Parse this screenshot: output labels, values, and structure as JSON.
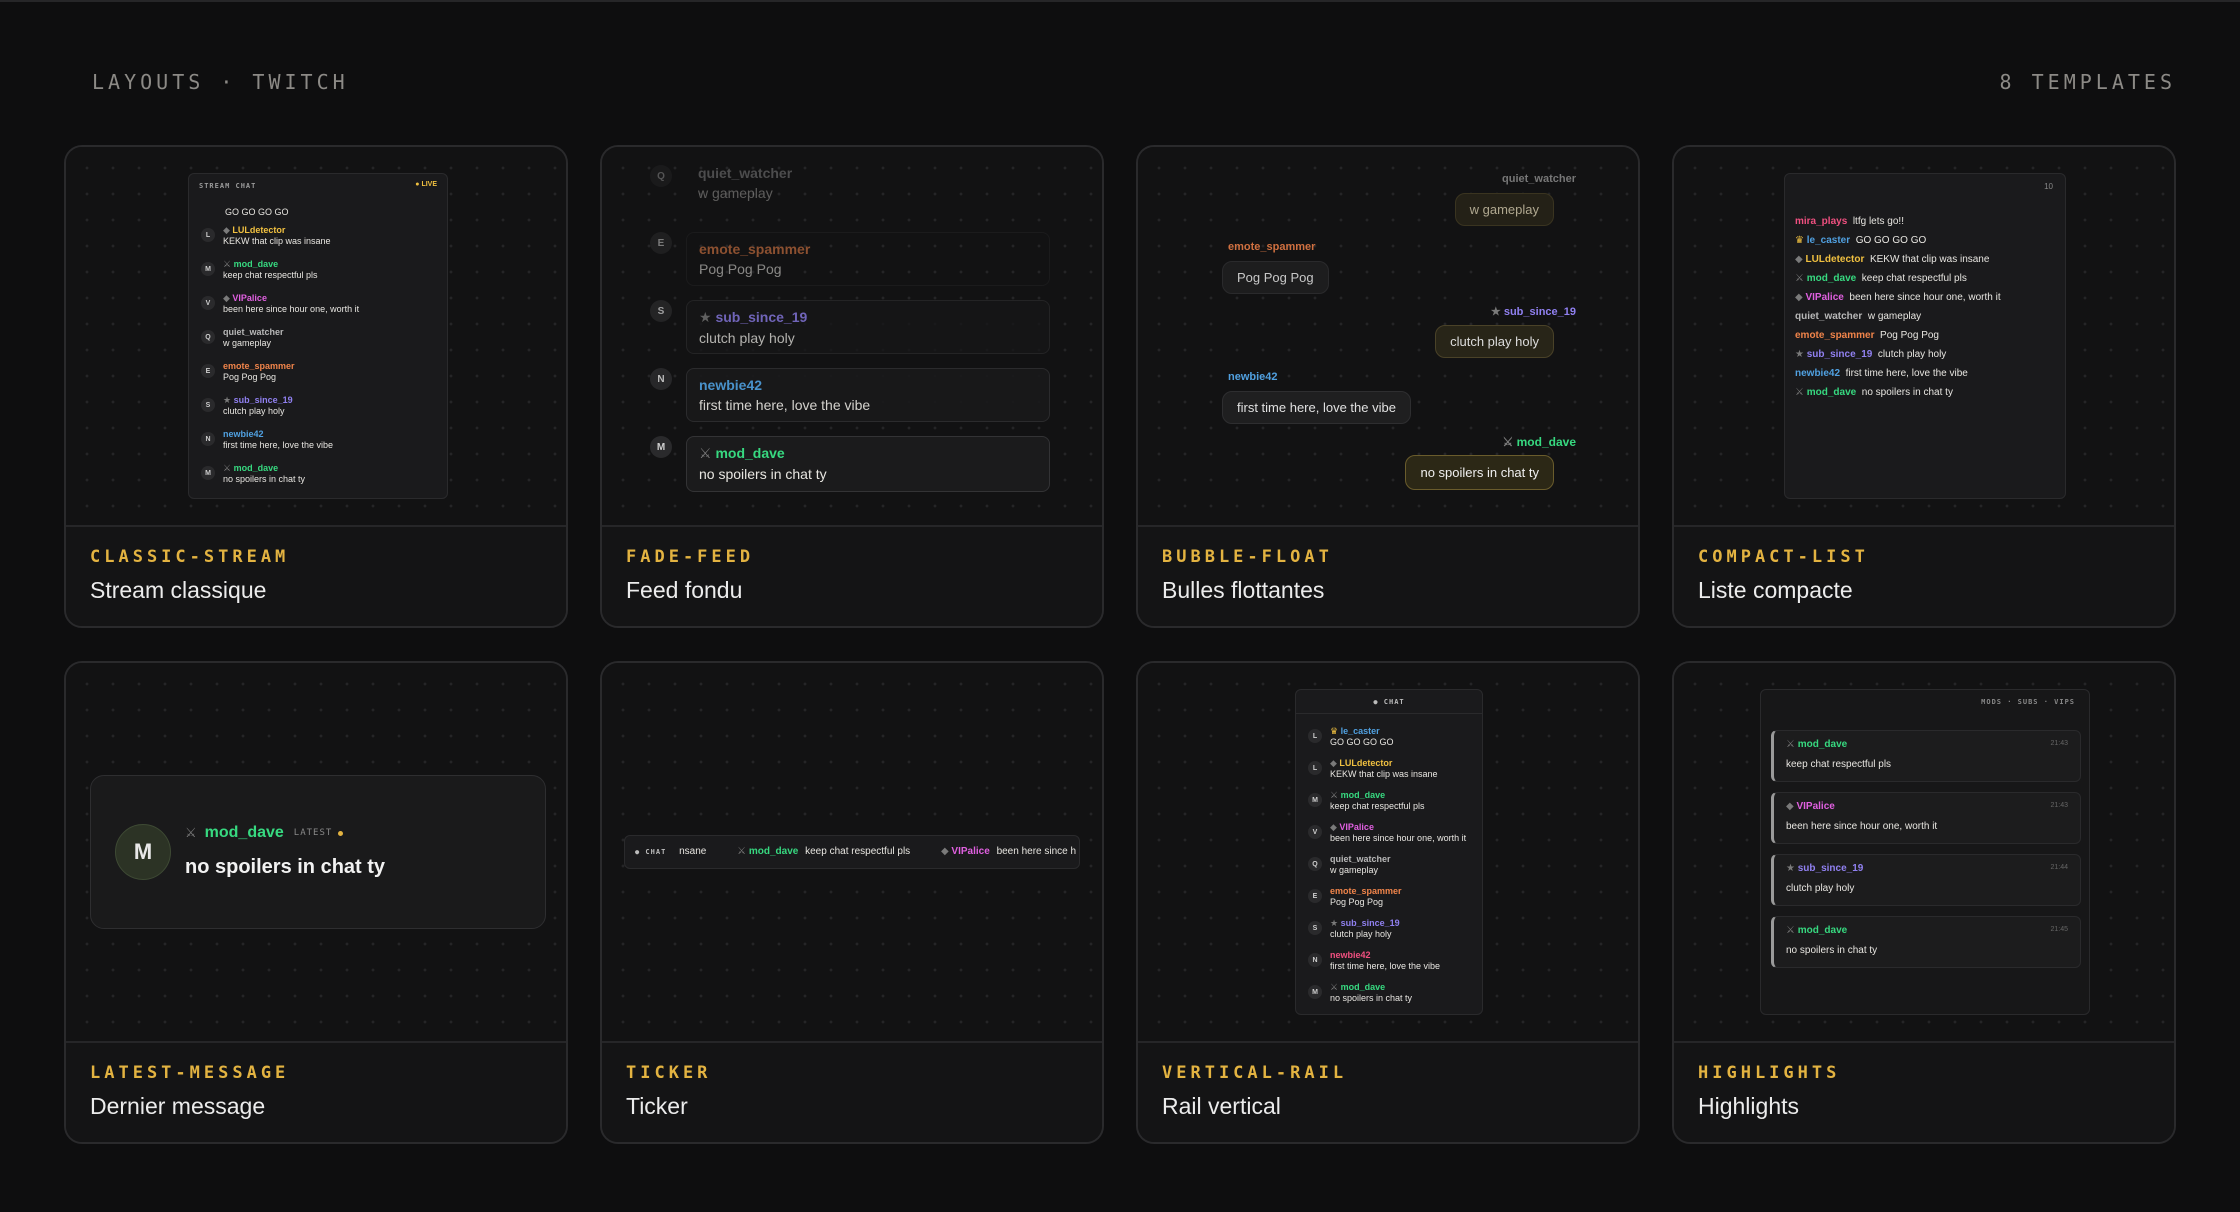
{
  "header": {
    "left": "LAYOUTS · TWITCH",
    "right": "8 TEMPLATES"
  },
  "cards": [
    {
      "slug": "CLASSIC-STREAM",
      "name": "Stream classique"
    },
    {
      "slug": "FADE-FEED",
      "name": "Feed fondu"
    },
    {
      "slug": "BUBBLE-FLOAT",
      "name": "Bulles flottantes"
    },
    {
      "slug": "COMPACT-LIST",
      "name": "Liste compacte"
    },
    {
      "slug": "LATEST-MESSAGE",
      "name": "Dernier message"
    },
    {
      "slug": "TICKER",
      "name": "Ticker"
    },
    {
      "slug": "VERTICAL-RAIL",
      "name": "Rail vertical"
    },
    {
      "slug": "HIGHLIGHTS",
      "name": "Highlights"
    }
  ],
  "classic": {
    "title": "STREAM CHAT",
    "live": "● LIVE",
    "first_text": "GO GO GO GO",
    "rows": [
      {
        "initial": "L",
        "user": "LULdetector",
        "text": "KEKW that clip was insane"
      },
      {
        "initial": "M",
        "user": "mod_dave",
        "text": "keep chat respectful pls"
      },
      {
        "initial": "V",
        "user": "VIPalice",
        "text": "been here since hour one, worth it"
      },
      {
        "initial": "Q",
        "user": "quiet_watcher",
        "text": "w gameplay"
      },
      {
        "initial": "E",
        "user": "emote_spammer",
        "text": "Pog Pog Pog"
      },
      {
        "initial": "S",
        "user": "sub_since_19",
        "text": "clutch play holy"
      },
      {
        "initial": "N",
        "user": "newbie42",
        "text": "first time here, love the vibe"
      },
      {
        "initial": "M",
        "user": "mod_dave",
        "text": "no spoilers in chat ty"
      }
    ]
  },
  "fade": {
    "rows": [
      {
        "initial": "Q",
        "user": "quiet_watcher",
        "text": "w gameplay"
      },
      {
        "initial": "E",
        "user": "emote_spammer",
        "text": "Pog Pog Pog"
      },
      {
        "initial": "S",
        "user": "sub_since_19",
        "text": "clutch play holy"
      },
      {
        "initial": "N",
        "user": "newbie42",
        "text": "first time here, love the vibe"
      },
      {
        "initial": "M",
        "user": "mod_dave",
        "text": "no spoilers in chat ty"
      }
    ]
  },
  "bubble": {
    "rows": [
      {
        "user": "quiet_watcher",
        "text": "w gameplay"
      },
      {
        "user": "emote_spammer",
        "text": "Pog Pog Pog"
      },
      {
        "user": "sub_since_19",
        "text": "clutch play holy"
      },
      {
        "user": "newbie42",
        "text": "first time here, love the vibe"
      },
      {
        "user": "mod_dave",
        "text": "no spoilers in chat ty"
      }
    ]
  },
  "compact": {
    "count": "10",
    "rows": [
      {
        "user": "mira_plays",
        "text": "ltfg lets go!!"
      },
      {
        "user": "le_caster",
        "text": "GO GO GO GO"
      },
      {
        "user": "LULdetector",
        "text": "KEKW that clip was insane"
      },
      {
        "user": "mod_dave",
        "text": "keep chat respectful pls"
      },
      {
        "user": "VIPalice",
        "text": "been here since hour one, worth it"
      },
      {
        "user": "quiet_watcher",
        "text": "w gameplay"
      },
      {
        "user": "emote_spammer",
        "text": "Pog Pog Pog"
      },
      {
        "user": "sub_since_19",
        "text": "clutch play holy"
      },
      {
        "user": "newbie42",
        "text": "first time here, love the vibe"
      },
      {
        "user": "mod_dave",
        "text": "no spoilers in chat ty"
      }
    ]
  },
  "latest": {
    "initial": "M",
    "user": "mod_dave",
    "badge": "LATEST",
    "text": "no spoilers in chat ty"
  },
  "ticker": {
    "label": "● CHAT",
    "lead": "nsane",
    "u1": "mod_dave",
    "t1": "keep chat respectful pls",
    "u2": "VIPalice",
    "t2": "been here since h"
  },
  "rail": {
    "title": "● CHAT",
    "rows": [
      {
        "initial": "L",
        "user": "le_caster",
        "text": "GO GO GO GO"
      },
      {
        "initial": "L",
        "user": "LULdetector",
        "text": "KEKW that clip was insane"
      },
      {
        "initial": "M",
        "user": "mod_dave",
        "text": "keep chat respectful pls"
      },
      {
        "initial": "V",
        "user": "VIPalice",
        "text": "been here since hour one, worth it"
      },
      {
        "initial": "Q",
        "user": "quiet_watcher",
        "text": "w gameplay"
      },
      {
        "initial": "E",
        "user": "emote_spammer",
        "text": "Pog Pog Pog"
      },
      {
        "initial": "S",
        "user": "sub_since_19",
        "text": "clutch play holy"
      },
      {
        "initial": "N",
        "user": "newbie42",
        "text": "first time here, love the vibe"
      },
      {
        "initial": "M",
        "user": "mod_dave",
        "text": "no spoilers in chat ty"
      }
    ]
  },
  "highlights": {
    "filter": "MODS · SUBS · VIPS",
    "rows": [
      {
        "user": "mod_dave",
        "text": "keep chat respectful pls",
        "time": "21:43"
      },
      {
        "user": "VIPalice",
        "text": "been here since hour one, worth it",
        "time": "21:43"
      },
      {
        "user": "sub_since_19",
        "text": "clutch play holy",
        "time": "21:44"
      },
      {
        "user": "mod_dave",
        "text": "no spoilers in chat ty",
        "time": "21:45"
      }
    ]
  },
  "colors": {
    "accent": "#e3b341",
    "mod": "#37d980",
    "vip": "#e060e0",
    "sub": "#9080f0",
    "caster": "#f0c040"
  }
}
